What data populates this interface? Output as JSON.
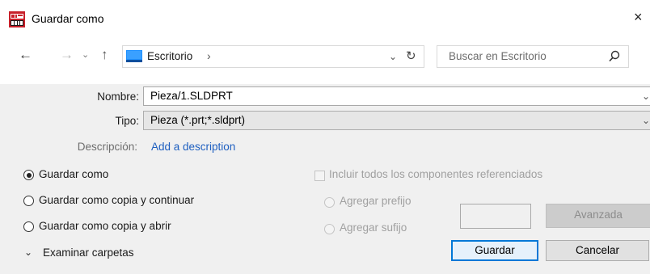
{
  "window": {
    "title": "Guardar como",
    "close_glyph": "×",
    "icon": "solidworks-app-icon"
  },
  "nav": {
    "back_glyph": "←",
    "forward_glyph": "→",
    "recent_glyph": "⌄",
    "up_glyph": "↑",
    "address": {
      "location": "Escritorio",
      "separator": "›",
      "dropdown_glyph": "⌄",
      "refresh_glyph": "↻"
    },
    "search": {
      "placeholder": "Buscar en Escritorio"
    }
  },
  "form": {
    "name_label": "Nombre:",
    "name_value": "Pieza/1.SLDPRT",
    "type_label": "Tipo:",
    "type_value": "Pieza (*.prt;*.sldprt)",
    "chevron_glyph": "⌄",
    "description_label": "Descripción:",
    "description_link": "Add a description"
  },
  "options": {
    "save_as": "Guardar como",
    "save_copy_continue": "Guardar como copia y continuar",
    "save_copy_open": "Guardar como copia y abrir",
    "include_refs": "Incluir todos los componentes referenciados",
    "add_prefix": "Agregar prefijo",
    "add_suffix": "Agregar sufijo",
    "selected": "save_as"
  },
  "footer": {
    "browse_folders": "Examinar carpetas",
    "browse_chevron": "⌄",
    "advanced_button": "Avanzada",
    "save_button": "Guardar",
    "cancel_button": "Cancelar"
  },
  "colors": {
    "accent": "#0078d7",
    "link": "#1e5fc0",
    "desktop_icon": "#1e90ff"
  }
}
